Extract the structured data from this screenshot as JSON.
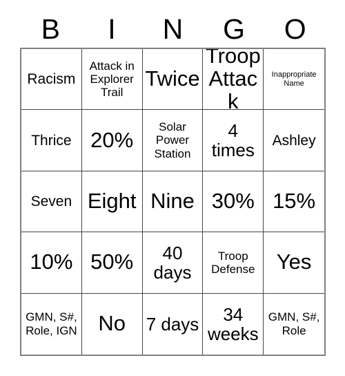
{
  "card": {
    "title": "BINGO",
    "header": {
      "letters": [
        "B",
        "I",
        "N",
        "G",
        "O"
      ]
    },
    "grid": {
      "columns": 5,
      "rows": 5,
      "border_color": "#808080",
      "cell_border_color": "#444444",
      "background_color": "#ffffff",
      "text_color": "#000000",
      "cells": [
        {
          "text": "Racism",
          "size": "md"
        },
        {
          "text": "Attack in Explorer Trail",
          "size": "sm"
        },
        {
          "text": "Twice",
          "size": "xl"
        },
        {
          "text": "Troop Attack",
          "size": "xl"
        },
        {
          "text": "Inappropriate Name",
          "size": "xs"
        },
        {
          "text": "Thrice",
          "size": "md"
        },
        {
          "text": "20%",
          "size": "xl"
        },
        {
          "text": "Solar Power Station",
          "size": "sm"
        },
        {
          "text": "4 times",
          "size": "lg"
        },
        {
          "text": "Ashley",
          "size": "md"
        },
        {
          "text": "Seven",
          "size": "md"
        },
        {
          "text": "Eight",
          "size": "xl"
        },
        {
          "text": "Nine",
          "size": "xl"
        },
        {
          "text": "30%",
          "size": "xl"
        },
        {
          "text": "15%",
          "size": "xl"
        },
        {
          "text": "10%",
          "size": "xl"
        },
        {
          "text": "50%",
          "size": "xl"
        },
        {
          "text": "40 days",
          "size": "lg"
        },
        {
          "text": "Troop Defense",
          "size": "sm"
        },
        {
          "text": "Yes",
          "size": "xl"
        },
        {
          "text": "GMN, S#, Role, IGN",
          "size": "sm"
        },
        {
          "text": "No",
          "size": "xl"
        },
        {
          "text": "7 days",
          "size": "lg"
        },
        {
          "text": "34 weeks",
          "size": "lg"
        },
        {
          "text": "GMN, S#, Role",
          "size": "sm"
        }
      ]
    }
  }
}
